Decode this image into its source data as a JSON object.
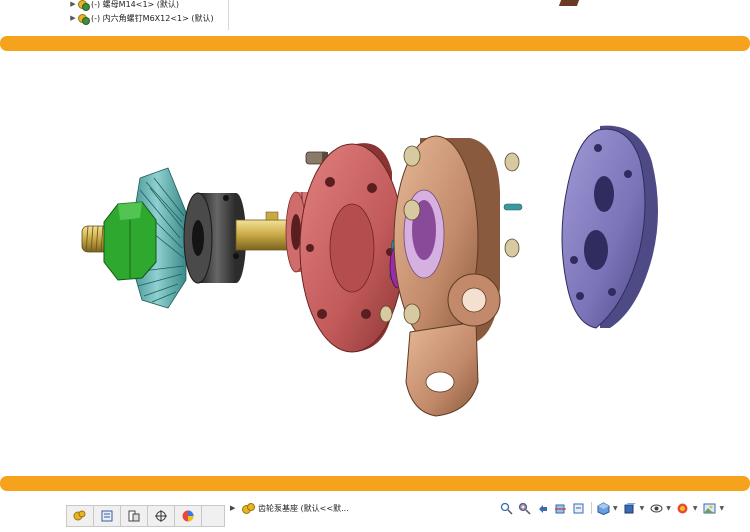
{
  "tree": {
    "items": [
      {
        "label": "(-) 螺母M14<1> (默认)"
      },
      {
        "label": "(-) 内六角螺钉M6X12<1> (默认)"
      }
    ]
  },
  "breadcrumb": {
    "assembly_label": "齿轮泵基座 (默认<<默..."
  },
  "colors": {
    "accent_bar": "#f5a31c",
    "housing": "#c28a6a",
    "flange": "#c25a5a",
    "cover_plate": "#7a74b8",
    "bevel_gear": "#5aa3a3",
    "nut": "#2fa82f",
    "collar": "#3a3a3a"
  },
  "panel_tabs": [
    {
      "icon": "feature-manager-icon"
    },
    {
      "icon": "property-manager-icon"
    },
    {
      "icon": "configuration-manager-icon"
    },
    {
      "icon": "dimxpert-manager-icon"
    },
    {
      "icon": "display-manager-icon"
    }
  ],
  "view_tools": [
    {
      "icon": "zoom-to-fit-icon"
    },
    {
      "icon": "zoom-to-area-icon"
    },
    {
      "icon": "previous-view-icon"
    },
    {
      "icon": "section-view-icon"
    },
    {
      "icon": "dynamic-annotation-icon"
    },
    {
      "icon": "view-orientation-icon"
    },
    {
      "icon": "display-style-icon"
    },
    {
      "icon": "hide-show-items-icon"
    },
    {
      "icon": "edit-appearance-icon"
    },
    {
      "icon": "apply-scene-icon"
    }
  ]
}
